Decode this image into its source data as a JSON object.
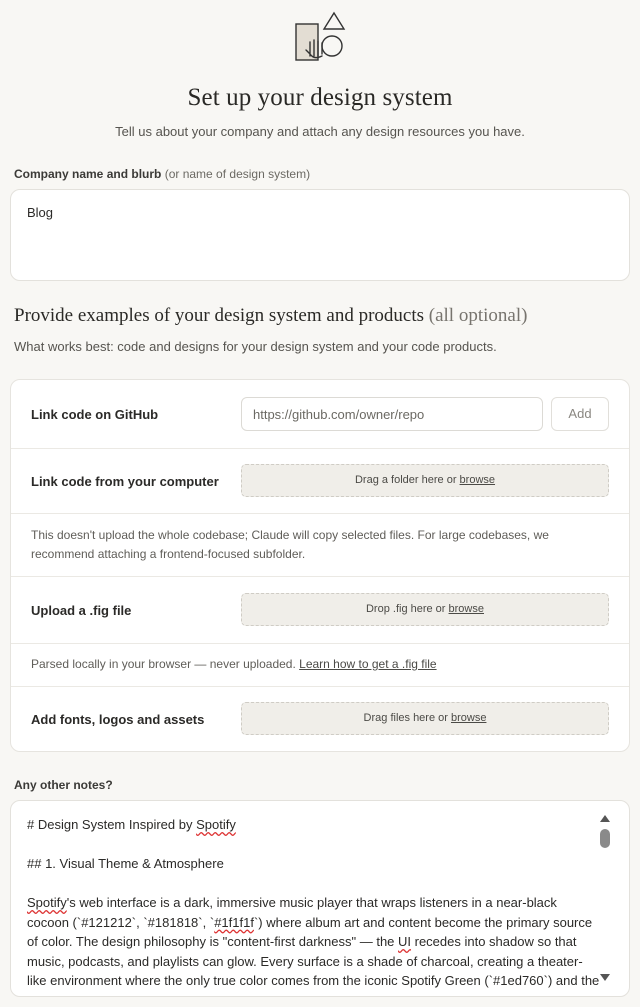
{
  "header": {
    "icon": "shapes-hand-icon",
    "title": "Set up your design system",
    "subtitle": "Tell us about your company and attach any design resources you have."
  },
  "company": {
    "label": "Company name and blurb",
    "label_hint": "(or name of design system)",
    "value": "Blog"
  },
  "examples": {
    "title": "Provide examples of your design system and products",
    "title_optional": "(all optional)",
    "subtitle": "What works best: code and designs for your design system and your code products.",
    "github": {
      "label": "Link code on GitHub",
      "placeholder": "https://github.com/owner/repo",
      "add_label": "Add"
    },
    "computer": {
      "label": "Link code from your computer",
      "drop_text": "Drag a folder here or",
      "browse": "browse",
      "note": "This doesn't upload the whole codebase; Claude will copy selected files. For large codebases, we recommend attaching a frontend-focused subfolder."
    },
    "fig": {
      "label": "Upload a .fig file",
      "drop_text": "Drop .fig here or",
      "browse": "browse",
      "note": "Parsed locally in your browser — never uploaded.",
      "note_link": "Learn how to get a .fig file"
    },
    "assets": {
      "label": "Add fonts, logos and assets",
      "drop_text": "Drag files here or",
      "browse": "browse"
    }
  },
  "notes": {
    "label": "Any other notes?",
    "h1_prefix": "# Design System Inspired by ",
    "h1_brand": "Spotify",
    "h2": "## 1. Visual Theme & Atmosphere",
    "p1_a": "Spotify",
    "p1_b": "'s web interface is a dark, immersive music player that wraps listeners in a near-black cocoon (`#121212`, `#181818`, `",
    "p1_c": "#1f1f1f",
    "p1_d": "`) where album art and content become the primary source of color. The design philosophy is \"content-first darkness\" — the ",
    "p1_e": "UI",
    "p1_f": " recedes into shadow so that music, podcasts, and playlists can glow. Every surface is a shade of charcoal, creating a theater-like environment where the only true color comes from the iconic Spotify Green (`#1ed760`) and the"
  }
}
